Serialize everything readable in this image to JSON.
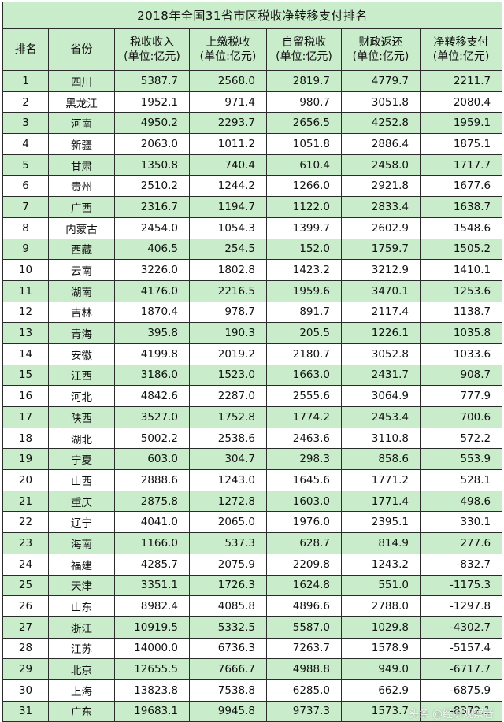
{
  "title": "2018年全国31省市区税收净转移支付排名",
  "headers": [
    {
      "line1": "排名",
      "line2": ""
    },
    {
      "line1": "省份",
      "line2": ""
    },
    {
      "line1": "税收收入",
      "line2": "(单位:亿元)"
    },
    {
      "line1": "上缴税收",
      "line2": "(单位:亿元)"
    },
    {
      "line1": "自留税收",
      "line2": "(单位:亿元)"
    },
    {
      "line1": "财政返还",
      "line2": "(单位:亿元)"
    },
    {
      "line1": "净转移支付",
      "line2": "(单位:亿元)"
    }
  ],
  "rows": [
    [
      "1",
      "四川",
      "5387.7",
      "2568.0",
      "2819.7",
      "4779.7",
      "2211.7"
    ],
    [
      "2",
      "黑龙江",
      "1952.1",
      "971.4",
      "980.7",
      "3051.8",
      "2080.4"
    ],
    [
      "3",
      "河南",
      "4950.2",
      "2293.7",
      "2656.5",
      "4252.8",
      "1959.1"
    ],
    [
      "4",
      "新疆",
      "2063.0",
      "1011.2",
      "1051.8",
      "2886.4",
      "1875.1"
    ],
    [
      "5",
      "甘肃",
      "1350.8",
      "740.4",
      "610.4",
      "2458.0",
      "1717.7"
    ],
    [
      "6",
      "贵州",
      "2510.2",
      "1244.2",
      "1266.0",
      "2921.8",
      "1677.6"
    ],
    [
      "7",
      "广西",
      "2316.7",
      "1194.7",
      "1122.0",
      "2833.4",
      "1638.7"
    ],
    [
      "8",
      "内蒙古",
      "2454.0",
      "1054.3",
      "1399.7",
      "2602.9",
      "1548.6"
    ],
    [
      "9",
      "西藏",
      "406.5",
      "254.5",
      "152.0",
      "1759.7",
      "1505.2"
    ],
    [
      "10",
      "云南",
      "3226.0",
      "1802.8",
      "1423.2",
      "3212.9",
      "1410.1"
    ],
    [
      "11",
      "湖南",
      "4176.0",
      "2216.5",
      "1959.6",
      "3470.1",
      "1253.6"
    ],
    [
      "12",
      "吉林",
      "1870.4",
      "978.7",
      "891.7",
      "2117.4",
      "1138.7"
    ],
    [
      "13",
      "青海",
      "395.8",
      "190.3",
      "205.5",
      "1226.1",
      "1035.8"
    ],
    [
      "14",
      "安徽",
      "4199.8",
      "2019.2",
      "2180.7",
      "3052.8",
      "1033.6"
    ],
    [
      "15",
      "江西",
      "3186.0",
      "1523.0",
      "1663.0",
      "2431.7",
      "908.7"
    ],
    [
      "16",
      "河北",
      "4842.6",
      "2287.0",
      "2555.6",
      "3064.9",
      "777.9"
    ],
    [
      "17",
      "陕西",
      "3527.0",
      "1752.8",
      "1774.2",
      "2453.4",
      "700.6"
    ],
    [
      "18",
      "湖北",
      "5002.2",
      "2538.6",
      "2463.6",
      "3110.8",
      "572.2"
    ],
    [
      "19",
      "宁夏",
      "603.0",
      "304.7",
      "298.3",
      "858.6",
      "553.9"
    ],
    [
      "20",
      "山西",
      "2888.6",
      "1243.0",
      "1645.6",
      "1771.2",
      "528.1"
    ],
    [
      "21",
      "重庆",
      "2875.8",
      "1272.8",
      "1603.0",
      "1771.4",
      "498.6"
    ],
    [
      "22",
      "辽宁",
      "4041.0",
      "2065.0",
      "1976.0",
      "2395.1",
      "330.1"
    ],
    [
      "23",
      "海南",
      "1166.0",
      "537.3",
      "628.7",
      "814.9",
      "277.6"
    ],
    [
      "24",
      "福建",
      "4285.7",
      "2075.9",
      "2209.8",
      "1243.2",
      "-832.7"
    ],
    [
      "25",
      "天津",
      "3351.1",
      "1726.3",
      "1624.8",
      "551.0",
      "-1175.3"
    ],
    [
      "26",
      "山东",
      "8982.4",
      "4085.8",
      "4896.6",
      "2788.0",
      "-1297.8"
    ],
    [
      "27",
      "浙江",
      "10919.5",
      "5332.5",
      "5587.0",
      "1029.8",
      "-4302.7"
    ],
    [
      "28",
      "江苏",
      "14000.0",
      "6736.3",
      "7263.7",
      "1578.9",
      "-5157.4"
    ],
    [
      "29",
      "北京",
      "12655.5",
      "7666.7",
      "4988.8",
      "949.0",
      "-6717.7"
    ],
    [
      "30",
      "上海",
      "13823.8",
      "7538.8",
      "6285.0",
      "662.9",
      "-6875.9"
    ],
    [
      "31",
      "广东",
      "19683.1",
      "9945.8",
      "9737.3",
      "1573.7",
      "-8372.1"
    ]
  ],
  "watermark": "头条 @经济观察者"
}
